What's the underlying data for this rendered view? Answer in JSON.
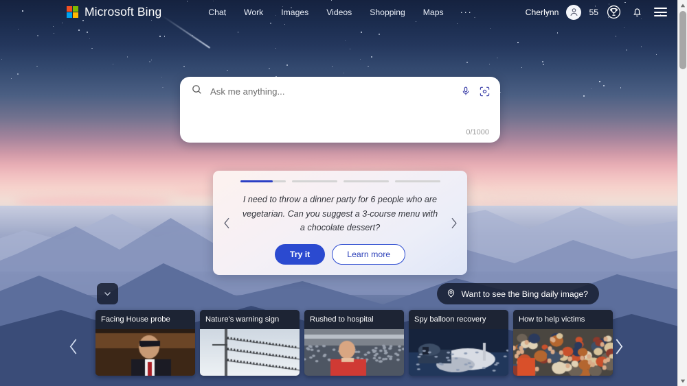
{
  "header": {
    "brand": "Microsoft Bing",
    "logo_icon": "microsoft-logo",
    "logo_colors": [
      "#f25022",
      "#7fba00",
      "#00a4ef",
      "#ffb900"
    ],
    "nav": [
      {
        "label": "Chat"
      },
      {
        "label": "Work"
      },
      {
        "label": "Images"
      },
      {
        "label": "Videos"
      },
      {
        "label": "Shopping"
      },
      {
        "label": "Maps"
      },
      {
        "label": "···"
      }
    ],
    "user_name": "Cherlynn",
    "avatar_icon": "person-avatar-icon",
    "reward_points": "55",
    "reward_icon": "trophy-icon",
    "notification_icon": "bell-icon",
    "menu_icon": "hamburger-menu-icon"
  },
  "search": {
    "placeholder": "Ask me anything...",
    "value": "",
    "counter": "0/1000",
    "search_icon": "search-icon",
    "mic_icon": "microphone-icon",
    "lens_icon": "visual-search-icon",
    "accent": "#3b3fa8"
  },
  "suggestion": {
    "segments": [
      {
        "active": true,
        "fill_pct": 72
      },
      {
        "active": false,
        "fill_pct": 0
      },
      {
        "active": false,
        "fill_pct": 0
      },
      {
        "active": false,
        "fill_pct": 0
      }
    ],
    "prompt": "I need to throw a dinner party for 6 people who are vegetarian. Can you suggest a 3-course menu with a chocolate dessert?",
    "try_label": "Try it",
    "learn_label": "Learn more",
    "prev_icon": "chevron-left-icon",
    "next_icon": "chevron-right-icon",
    "primary_color": "#2b4ad0"
  },
  "bottom": {
    "expand_icon": "chevron-down-icon",
    "daily_image_label": "Want to see the Bing daily image?",
    "daily_image_icon": "location-pin-icon",
    "prev_icon": "chevron-left-icon",
    "next_icon": "chevron-right-icon",
    "cards": [
      {
        "title": "Facing House probe",
        "scene": "politician"
      },
      {
        "title": "Nature's warning sign",
        "scene": "birds-wires"
      },
      {
        "title": "Rushed to hospital",
        "scene": "stadium-man"
      },
      {
        "title": "Spy balloon recovery",
        "scene": "boat-recovery"
      },
      {
        "title": "How to help victims",
        "scene": "crowd"
      }
    ]
  },
  "scrollbar": {
    "up_icon": "scroll-up-arrow-icon",
    "down_icon": "scroll-down-arrow-icon",
    "thumb": "scroll-thumb"
  }
}
